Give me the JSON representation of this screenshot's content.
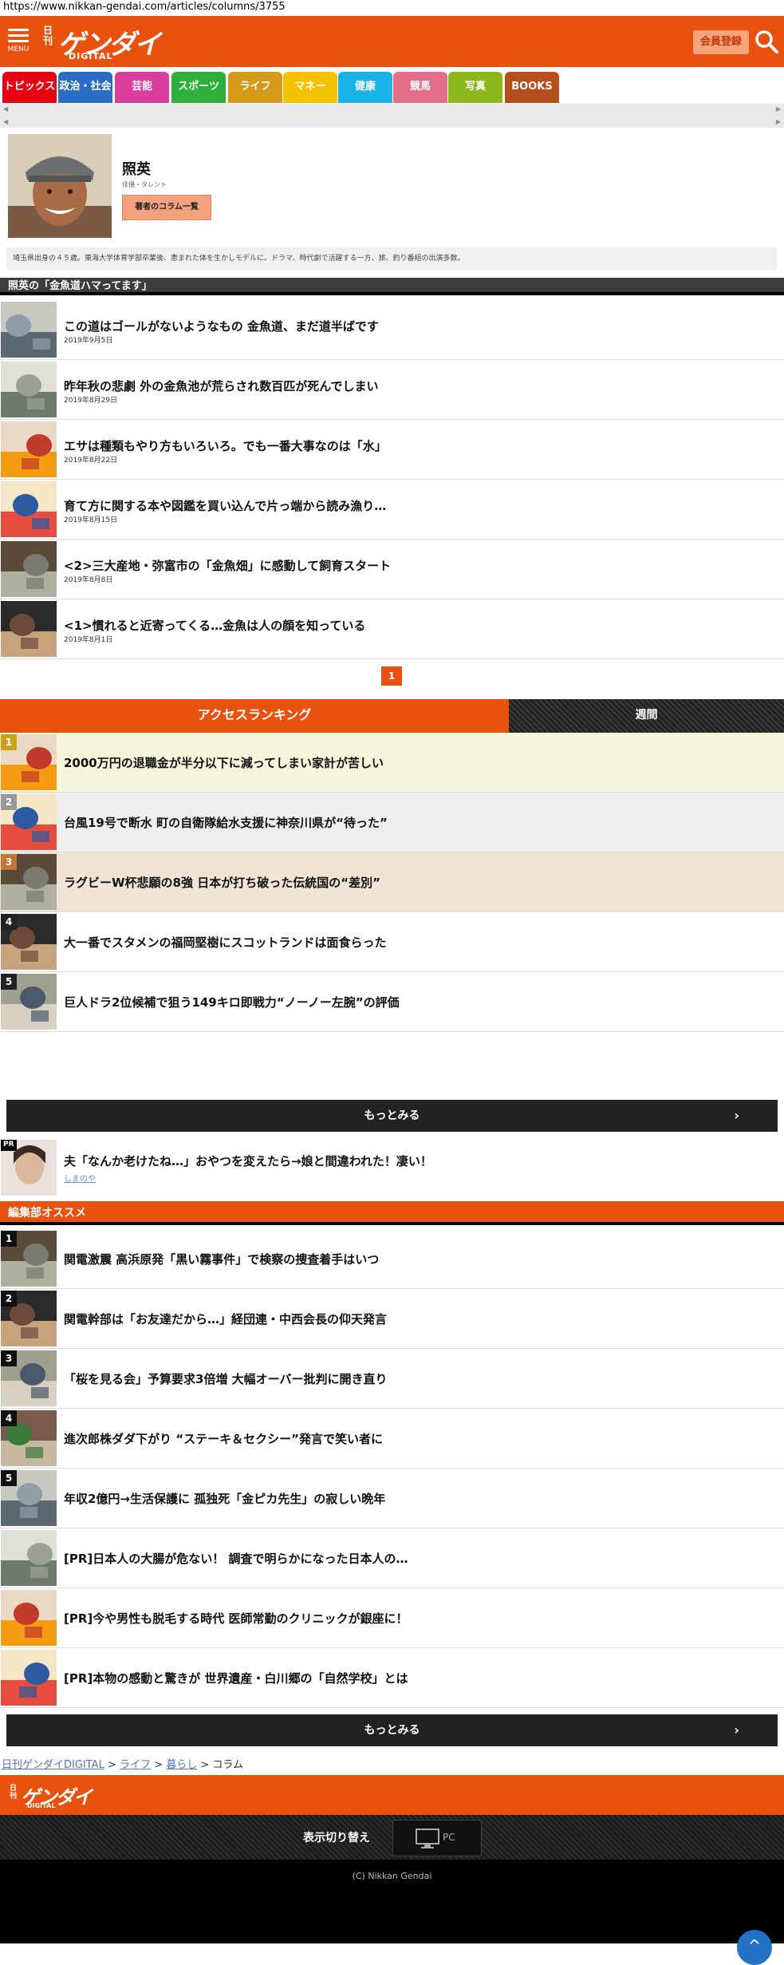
{
  "url": "https://www.nikkan-gendai.com/articles/columns/3755",
  "header": {
    "menu_label": "MENU",
    "logo_nikkan": "日刊",
    "logo_gendai": "ゲンダイ",
    "logo_digital": "DIGITAL",
    "register_label": "会員登録"
  },
  "tabs": [
    {
      "label": "トピックス",
      "color": "#e60012"
    },
    {
      "label": "政治・社会",
      "color": "#2b6cc4"
    },
    {
      "label": "芸能",
      "color": "#d93e9f"
    },
    {
      "label": "スポーツ",
      "color": "#2eae3a"
    },
    {
      "label": "ライフ",
      "color": "#d69a1a"
    },
    {
      "label": "マネー",
      "color": "#f5c200"
    },
    {
      "label": "健康",
      "color": "#1ab3e8"
    },
    {
      "label": "競馬",
      "color": "#e26e8a"
    },
    {
      "label": "写真",
      "color": "#8bb71d"
    },
    {
      "label": "BOOKS",
      "color": "#b5501e"
    }
  ],
  "profile": {
    "name": "照英",
    "role": "俳優・タレント",
    "columns_button": "著者のコラム一覧",
    "bio": "埼玉県出身の４５歳。東海大学体育学部卒業後、恵まれた体を生かしモデルに。ドラマ、時代劇で活躍する一方、旅、釣り番組の出演多数。"
  },
  "column_section_title": "照英の「金魚道ハマってます」",
  "articles": [
    {
      "title": "この道はゴールがないようなもの 金魚道、まだ道半ばです",
      "date": "2019年9月5日"
    },
    {
      "title": "昨年秋の悲劇 外の金魚池が荒らされ数百匹が死んでしまい",
      "date": "2019年8月29日"
    },
    {
      "title": "エサは種類もやり方もいろいろ。でも一番大事なのは「水」",
      "date": "2019年8月22日"
    },
    {
      "title": "育て方に関する本や図鑑を買い込んで片っ端から読み漁り…",
      "date": "2019年8月15日"
    },
    {
      "title": "<2>三大産地・弥富市の「金魚畑」に感動して飼育スタート",
      "date": "2019年8月8日"
    },
    {
      "title": "<1>慣れると近寄ってくる…金魚は人の顔を知っている",
      "date": "2019年8月1日"
    }
  ],
  "pager": "1",
  "ranking": {
    "tab_access": "アクセスランキング",
    "tab_weekly": "週間",
    "items": [
      {
        "rank": "1",
        "title": "2000万円の退職金が半分以下に減ってしまい家計が苦しい",
        "bg": "#f7f5dc",
        "badge": "#c9a41a"
      },
      {
        "rank": "2",
        "title": "台風19号で断水 町の自衛隊給水支援に神奈川県が“待った”",
        "bg": "#eeeeee",
        "badge": "#999999"
      },
      {
        "rank": "3",
        "title": "ラグビーW杯悲願の8強 日本が打ち破った伝統国の“差別”",
        "bg": "#f0e4d4",
        "badge": "#c4763a"
      },
      {
        "rank": "4",
        "title": "大一番でスタメンの福岡堅樹にスコットランドは面食らった",
        "bg": "#ffffff",
        "badge": "#222222"
      },
      {
        "rank": "5",
        "title": "巨人ドラ2位候補で狙う149キロ即戦力“ノーノー左腕”の評価",
        "bg": "#ffffff",
        "badge": "#222222"
      }
    ]
  },
  "more_label": "もっとみる",
  "pr": {
    "badge": "PR",
    "title": "夫「なんか老けたね…」おやつを変えたら→娘と間違われた！凄い！",
    "source": "しまのや"
  },
  "editor": {
    "title": "編集部オススメ",
    "items": [
      {
        "rank": "1",
        "title": "関電激震 高浜原発「黒い霧事件」で検察の捜査着手はいつ"
      },
      {
        "rank": "2",
        "title": "関電幹部は「お友達だから…」経団連・中西会長の仰天発言"
      },
      {
        "rank": "3",
        "title": "「桜を見る会」予算要求3倍増 大幅オーバー批判に開き直り"
      },
      {
        "rank": "4",
        "title": "進次郎株ダダ下がり “ステーキ＆セクシー”発言で笑い者に"
      },
      {
        "rank": "5",
        "title": "年収2億円→生活保護に 孤独死「金ピカ先生」の寂しい晩年"
      },
      {
        "rank": "",
        "title": "[PR]日本人の大腸が危ない！ 調査で明らかになった日本人の…"
      },
      {
        "rank": "",
        "title": "[PR]今や男性も脱毛する時代 医師常勤のクリニックが銀座に！"
      },
      {
        "rank": "",
        "title": "[PR]本物の感動と驚きが 世界遺産・白川郷の「自然学校」とは"
      }
    ]
  },
  "breadcrumb": {
    "home": "日刊ゲンダイDIGITAL",
    "sep": ">",
    "life": "ライフ",
    "living": "暮らし",
    "current": "コラム"
  },
  "footer": {
    "switch_label": "表示切り替え",
    "pc_label": "PC",
    "copyright": "(C)  Nikkan Gendai"
  }
}
